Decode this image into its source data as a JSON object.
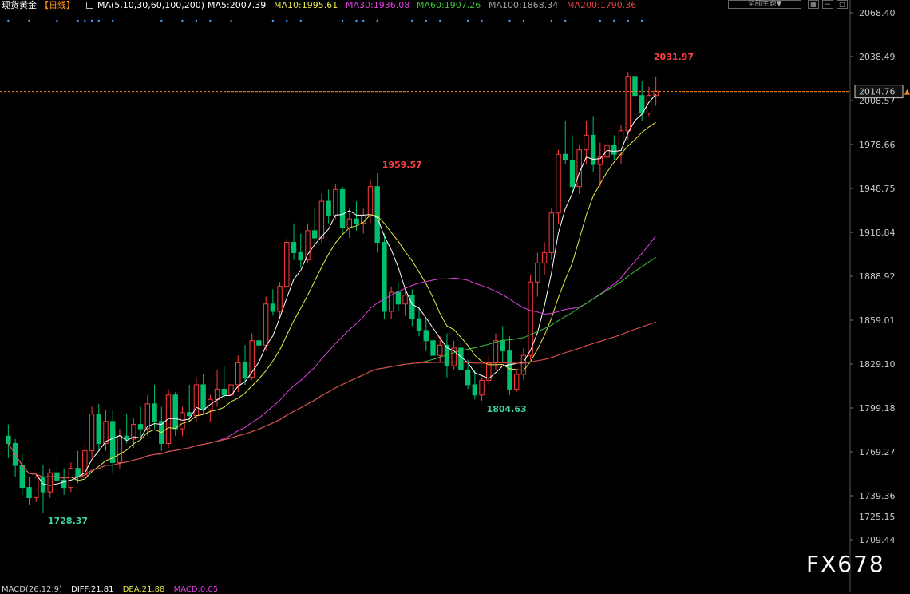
{
  "header": {
    "instrument": "现货黄金",
    "period": "【日线】",
    "ma_params": "MA(5,10,30,60,100,200)",
    "ma_values": [
      {
        "label": "MA5:2007.39",
        "color": "#ffffff"
      },
      {
        "label": "MA10:1995.61",
        "color": "#e8e84a"
      },
      {
        "label": "MA30:1936.08",
        "color": "#e040e0"
      },
      {
        "label": "MA60:1907.26",
        "color": "#40c040"
      },
      {
        "label": "MA100:1868.34",
        "color": "#a0a0a0"
      },
      {
        "label": "MA200:1790.36",
        "color": "#e04040"
      }
    ]
  },
  "toolbar": {
    "theme_label": "全部主题▼"
  },
  "current_price": "2014.76",
  "watermark": "FX678",
  "macd_bar": {
    "label": "MACD(26,12,9)",
    "diff": "DIFF:21.81",
    "dea": "DEA:21.88",
    "macd": "MACD:0.05"
  },
  "colors": {
    "up": "#ff3b3b",
    "down": "#00c070",
    "ma5": "#ffffff",
    "ma10": "#e8e84a",
    "ma30": "#e040e0",
    "ma60": "#40c040",
    "ma100": "#a0a0a0",
    "ma200": "#e04040",
    "price_line": "#ff9020"
  },
  "chart_data": {
    "type": "candlestick",
    "title": "现货黄金【日线】",
    "ylim": [
      1709.44,
      2068.4
    ],
    "y_ticks": [
      "2068.40",
      "2038.49",
      "2008.57",
      "1978.66",
      "1948.75",
      "1918.84",
      "1888.92",
      "1859.01",
      "1829.10",
      "1799.18",
      "1769.27",
      "1739.36",
      "1709.44"
    ],
    "extra_tick": "1725.15",
    "annotations": [
      {
        "label": "2031.97",
        "type": "high"
      },
      {
        "label": "1959.57",
        "type": "high"
      },
      {
        "label": "1804.63",
        "type": "low"
      },
      {
        "label": "1728.37",
        "type": "low"
      }
    ],
    "ohlc": [
      [
        1780,
        1788,
        1765,
        1775
      ],
      [
        1775,
        1778,
        1752,
        1760
      ],
      [
        1760,
        1768,
        1740,
        1745
      ],
      [
        1745,
        1752,
        1733,
        1738
      ],
      [
        1738,
        1755,
        1735,
        1752
      ],
      [
        1752,
        1760,
        1728,
        1742
      ],
      [
        1742,
        1758,
        1738,
        1755
      ],
      [
        1755,
        1765,
        1745,
        1750
      ],
      [
        1750,
        1758,
        1740,
        1745
      ],
      [
        1745,
        1762,
        1742,
        1758
      ],
      [
        1758,
        1770,
        1748,
        1752
      ],
      [
        1752,
        1775,
        1750,
        1770
      ],
      [
        1770,
        1800,
        1765,
        1795
      ],
      [
        1795,
        1802,
        1770,
        1775
      ],
      [
        1775,
        1798,
        1770,
        1790
      ],
      [
        1790,
        1798,
        1755,
        1762
      ],
      [
        1762,
        1785,
        1758,
        1780
      ],
      [
        1780,
        1795,
        1775,
        1778
      ],
      [
        1778,
        1792,
        1772,
        1788
      ],
      [
        1788,
        1800,
        1780,
        1785
      ],
      [
        1785,
        1808,
        1780,
        1802
      ],
      [
        1802,
        1815,
        1785,
        1790
      ],
      [
        1790,
        1800,
        1770,
        1775
      ],
      [
        1775,
        1812,
        1772,
        1808
      ],
      [
        1808,
        1810,
        1780,
        1785
      ],
      [
        1785,
        1800,
        1780,
        1796
      ],
      [
        1796,
        1815,
        1790,
        1794
      ],
      [
        1794,
        1820,
        1790,
        1815
      ],
      [
        1815,
        1822,
        1795,
        1798
      ],
      [
        1798,
        1808,
        1790,
        1805
      ],
      [
        1805,
        1825,
        1800,
        1812
      ],
      [
        1812,
        1828,
        1805,
        1808
      ],
      [
        1808,
        1818,
        1800,
        1815
      ],
      [
        1815,
        1835,
        1810,
        1830
      ],
      [
        1830,
        1842,
        1815,
        1820
      ],
      [
        1820,
        1850,
        1818,
        1845
      ],
      [
        1845,
        1862,
        1838,
        1842
      ],
      [
        1842,
        1875,
        1838,
        1870
      ],
      [
        1870,
        1880,
        1862,
        1865
      ],
      [
        1865,
        1885,
        1860,
        1882
      ],
      [
        1882,
        1915,
        1878,
        1912
      ],
      [
        1912,
        1925,
        1900,
        1905
      ],
      [
        1905,
        1918,
        1895,
        1900
      ],
      [
        1900,
        1925,
        1898,
        1920
      ],
      [
        1920,
        1935,
        1912,
        1915
      ],
      [
        1915,
        1945,
        1912,
        1940
      ],
      [
        1940,
        1948,
        1925,
        1930
      ],
      [
        1930,
        1952,
        1928,
        1948
      ],
      [
        1948,
        1950,
        1918,
        1922
      ],
      [
        1922,
        1935,
        1915,
        1928
      ],
      [
        1928,
        1940,
        1920,
        1925
      ],
      [
        1925,
        1935,
        1918,
        1930
      ],
      [
        1930,
        1955,
        1925,
        1950
      ],
      [
        1950,
        1959,
        1905,
        1912
      ],
      [
        1912,
        1918,
        1860,
        1865
      ],
      [
        1865,
        1882,
        1860,
        1878
      ],
      [
        1878,
        1885,
        1865,
        1870
      ],
      [
        1870,
        1880,
        1862,
        1876
      ],
      [
        1876,
        1880,
        1855,
        1860
      ],
      [
        1860,
        1868,
        1848,
        1852
      ],
      [
        1852,
        1860,
        1838,
        1845
      ],
      [
        1845,
        1850,
        1828,
        1835
      ],
      [
        1835,
        1848,
        1830,
        1842
      ],
      [
        1842,
        1850,
        1820,
        1828
      ],
      [
        1828,
        1845,
        1825,
        1840
      ],
      [
        1840,
        1845,
        1820,
        1825
      ],
      [
        1825,
        1832,
        1812,
        1815
      ],
      [
        1815,
        1825,
        1805,
        1808
      ],
      [
        1808,
        1820,
        1804,
        1818
      ],
      [
        1818,
        1835,
        1815,
        1830
      ],
      [
        1830,
        1850,
        1825,
        1845
      ],
      [
        1845,
        1855,
        1830,
        1838
      ],
      [
        1838,
        1848,
        1808,
        1812
      ],
      [
        1812,
        1825,
        1810,
        1822
      ],
      [
        1822,
        1840,
        1818,
        1835
      ],
      [
        1835,
        1890,
        1832,
        1885
      ],
      [
        1885,
        1905,
        1875,
        1898
      ],
      [
        1898,
        1912,
        1890,
        1905
      ],
      [
        1905,
        1935,
        1900,
        1932
      ],
      [
        1932,
        1975,
        1925,
        1972
      ],
      [
        1972,
        1995,
        1965,
        1968
      ],
      [
        1968,
        1985,
        1945,
        1950
      ],
      [
        1950,
        1978,
        1945,
        1975
      ],
      [
        1975,
        1995,
        1965,
        1985
      ],
      [
        1985,
        1998,
        1960,
        1965
      ],
      [
        1965,
        1980,
        1950,
        1970
      ],
      [
        1970,
        1982,
        1962,
        1978
      ],
      [
        1978,
        1985,
        1968,
        1972
      ],
      [
        1972,
        1992,
        1965,
        1988
      ],
      [
        1988,
        2028,
        1982,
        2025
      ],
      [
        2025,
        2032,
        2008,
        2012
      ],
      [
        2012,
        2022,
        1995,
        2000
      ],
      [
        2000,
        2018,
        1998,
        2012
      ],
      [
        2012,
        2025,
        2005,
        2015
      ]
    ],
    "ma_series": [
      {
        "name": "MA5"
      },
      {
        "name": "MA10"
      },
      {
        "name": "MA30"
      },
      {
        "name": "MA60"
      },
      {
        "name": "MA100"
      },
      {
        "name": "MA200"
      }
    ]
  }
}
